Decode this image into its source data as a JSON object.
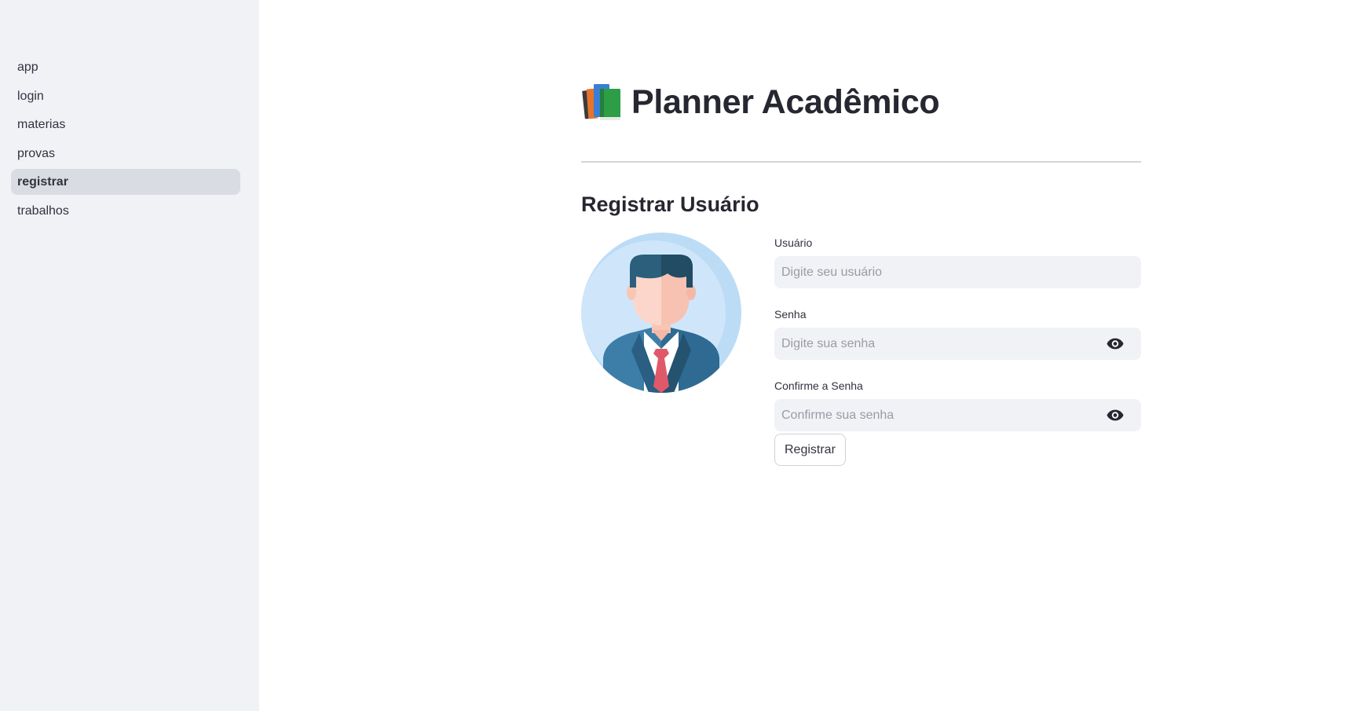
{
  "sidebar": {
    "items": [
      {
        "label": "app"
      },
      {
        "label": "login"
      },
      {
        "label": "materias"
      },
      {
        "label": "provas"
      },
      {
        "label": "registrar",
        "active": true
      },
      {
        "label": "trabalhos"
      }
    ]
  },
  "header": {
    "title": "Planner Acadêmico",
    "icon": "books-icon"
  },
  "section": {
    "title": "Registrar Usuário",
    "avatar_icon": "user-avatar-icon"
  },
  "form": {
    "username": {
      "label": "Usuário",
      "placeholder": "Digite seu usuário",
      "value": ""
    },
    "password": {
      "label": "Senha",
      "placeholder": "Digite sua senha",
      "value": ""
    },
    "confirm": {
      "label": "Confirme a Senha",
      "placeholder": "Confirme sua senha",
      "value": ""
    },
    "submit_label": "Registrar"
  },
  "colors": {
    "sidebar_bg": "#f0f2f6",
    "active_item_bg": "#dadce4",
    "input_bg": "#f0f2f6",
    "text": "#31333f"
  }
}
